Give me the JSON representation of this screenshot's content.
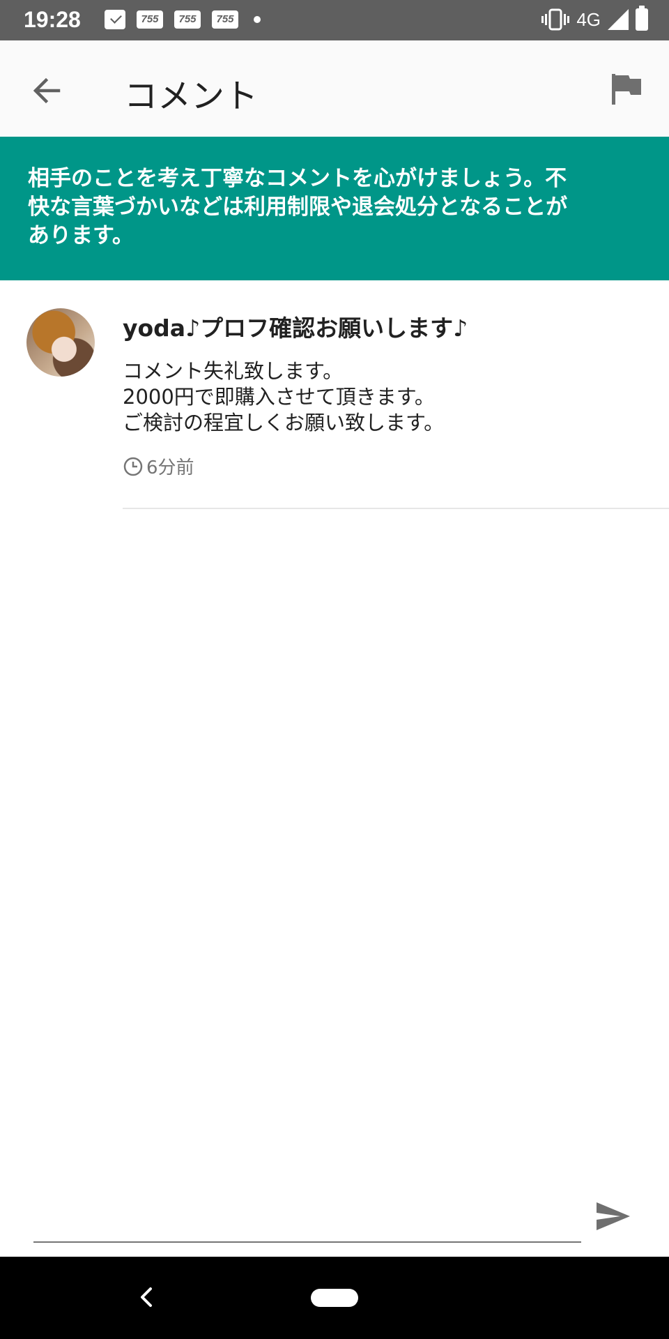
{
  "status_bar": {
    "time": "19:28",
    "notification_badges": [
      "755",
      "755",
      "755"
    ],
    "network": "4G"
  },
  "app_bar": {
    "title": "コメント",
    "back_icon": "arrow-back-icon",
    "report_icon": "flag-icon"
  },
  "notice": {
    "lines": [
      "相手のことを考え丁寧なコメントを心がけましょう。不",
      "快な言葉づかいなどは利用制限や退会処分となることが",
      "あります。"
    ]
  },
  "comments": [
    {
      "user_name": "yoda♪プロフ確認お願いします♪",
      "body_lines": [
        "コメント失礼致します。",
        "2000円で即購入させて頂きます。",
        "ご検討の程宜しくお願い致します。"
      ],
      "time_ago": "6分前"
    }
  ],
  "input": {
    "value": "",
    "placeholder": ""
  },
  "colors": {
    "status_bar": "#5f5f5f",
    "app_bar": "#fafafa",
    "banner": "#009688",
    "nav_bar": "#000000"
  }
}
